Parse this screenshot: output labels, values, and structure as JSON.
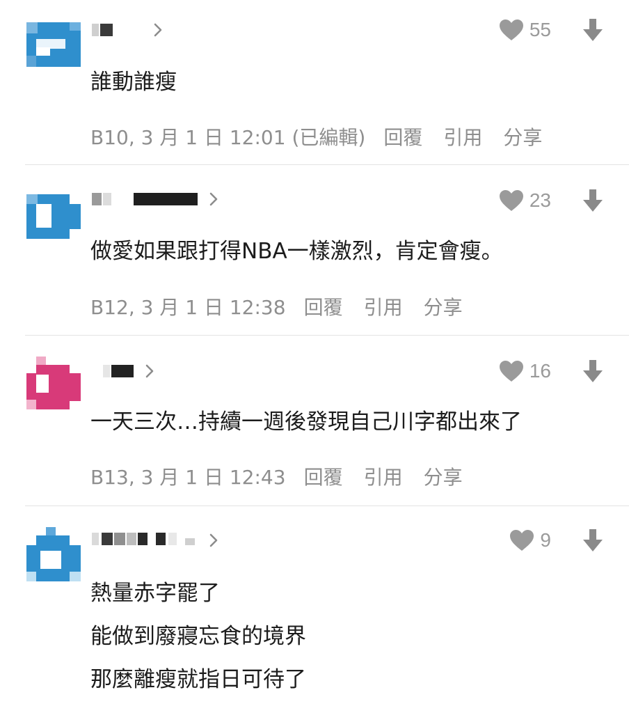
{
  "comments": [
    {
      "likes": "55",
      "body": [
        "誰動誰瘦"
      ],
      "timestamp": "B10, 3 月 1 日 12:01 (已編輯)",
      "actions": {
        "reply": "回覆",
        "quote": "引用",
        "share": "分享"
      }
    },
    {
      "likes": "23",
      "body": [
        "做愛如果跟打得NBA一樣激烈，肯定會瘦。"
      ],
      "timestamp": "B12, 3 月 1 日 12:38",
      "actions": {
        "reply": "回覆",
        "quote": "引用",
        "share": "分享"
      }
    },
    {
      "likes": "16",
      "body": [
        "一天三次…持續一週後發現自己川字都出來了"
      ],
      "timestamp": "B13, 3 月 1 日 12:43",
      "actions": {
        "reply": "回覆",
        "quote": "引用",
        "share": "分享"
      }
    },
    {
      "likes": "9",
      "body": [
        "熱量赤字罷了",
        "能做到廢寢忘食的境界",
        "那麼離瘦就指日可待了"
      ]
    }
  ],
  "icons": {
    "like": "heart-icon",
    "dislike": "down-arrow-icon",
    "profile": "chevron-right-icon"
  },
  "colors": {
    "avatar_blue": "#2f8fcd",
    "avatar_pink": "#d83a79",
    "icon_gray": "#9a9a9a",
    "meta_gray": "#8e8e8e"
  }
}
